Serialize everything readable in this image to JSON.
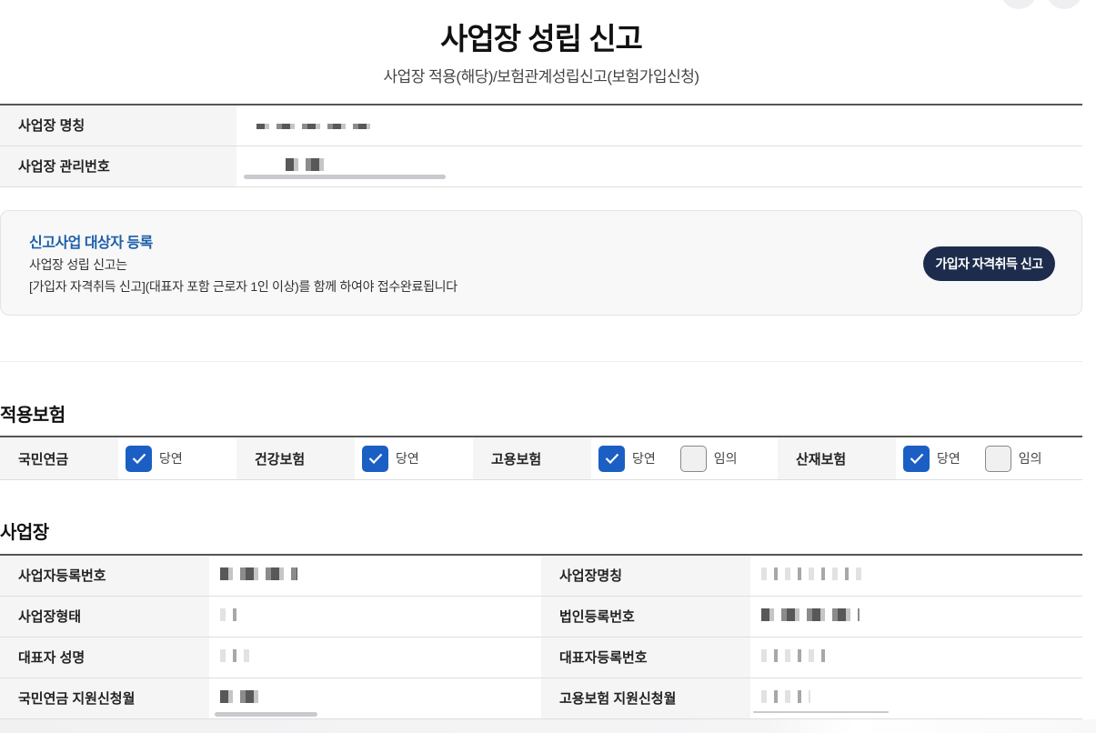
{
  "header": {
    "title": "사업장 성립 신고",
    "subtitle": "사업장 적용(해당)/보험관계성립신고(보험가입신청)"
  },
  "summary": {
    "rows": [
      {
        "label": "사업장 명칭"
      },
      {
        "label": "사업장 관리번호"
      }
    ]
  },
  "notice": {
    "title": "신고사업 대상자 등록",
    "line1": "사업장 성립 신고는",
    "line2": "[가입자 자격취득 신고](대표자 포함 근로자 1인 이상)를 함께 하여야 접수완료됩니다",
    "button": "가입자 자격취득 신고"
  },
  "insurance": {
    "section_title": "적용보험",
    "items": [
      {
        "label": "국민연금",
        "options": [
          {
            "label": "당연",
            "checked": true
          }
        ]
      },
      {
        "label": "건강보험",
        "options": [
          {
            "label": "당연",
            "checked": true
          }
        ]
      },
      {
        "label": "고용보험",
        "options": [
          {
            "label": "당연",
            "checked": true
          },
          {
            "label": "임의",
            "checked": false
          }
        ]
      },
      {
        "label": "산재보험",
        "options": [
          {
            "label": "당연",
            "checked": true
          },
          {
            "label": "임의",
            "checked": false
          }
        ]
      }
    ]
  },
  "business": {
    "section_title": "사업장",
    "rows": [
      {
        "left": "사업자등록번호",
        "right": "사업장명칭"
      },
      {
        "left": "사업장형태",
        "right": "법인등록번호"
      },
      {
        "left": "대표자 성명",
        "right": "대표자등록번호"
      },
      {
        "left": "국민연금 지원신청월",
        "right": "고용보험 지원신청월"
      }
    ]
  },
  "colors": {
    "accent": "#1b5fc4",
    "notice_title": "#1b5fa8",
    "button_bg": "#1d2c4c"
  }
}
